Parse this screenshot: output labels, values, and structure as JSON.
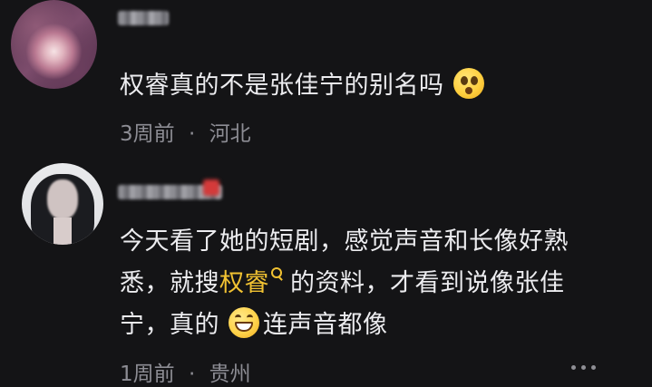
{
  "comments": [
    {
      "avatar": "galaxy-avatar",
      "text": "权睿真的不是张佳宁的别名吗",
      "emoji": "shocked-face-emoji",
      "time": "3周前",
      "separator": "·",
      "location": "河北"
    },
    {
      "avatar": "person-avatar",
      "text_line1": "今天看了她的短剧，感觉声音和长像好熟",
      "text_line2_prefix": "悉，就搜",
      "text_line2_highlight": "权睿",
      "text_line2_suffix": "的资料，才看到说像张佳",
      "text_line3_prefix": "宁，真的",
      "emoji": "grinning-face-emoji",
      "text_line3_suffix": "连声音都像",
      "time": "1周前",
      "separator": "·",
      "location": "贵州",
      "more_icon": "more-dots-icon"
    }
  ],
  "colors": {
    "background": "#141416",
    "primary_text": "#ececef",
    "meta_text": "#8d8d94",
    "highlight": "#f1c232"
  }
}
